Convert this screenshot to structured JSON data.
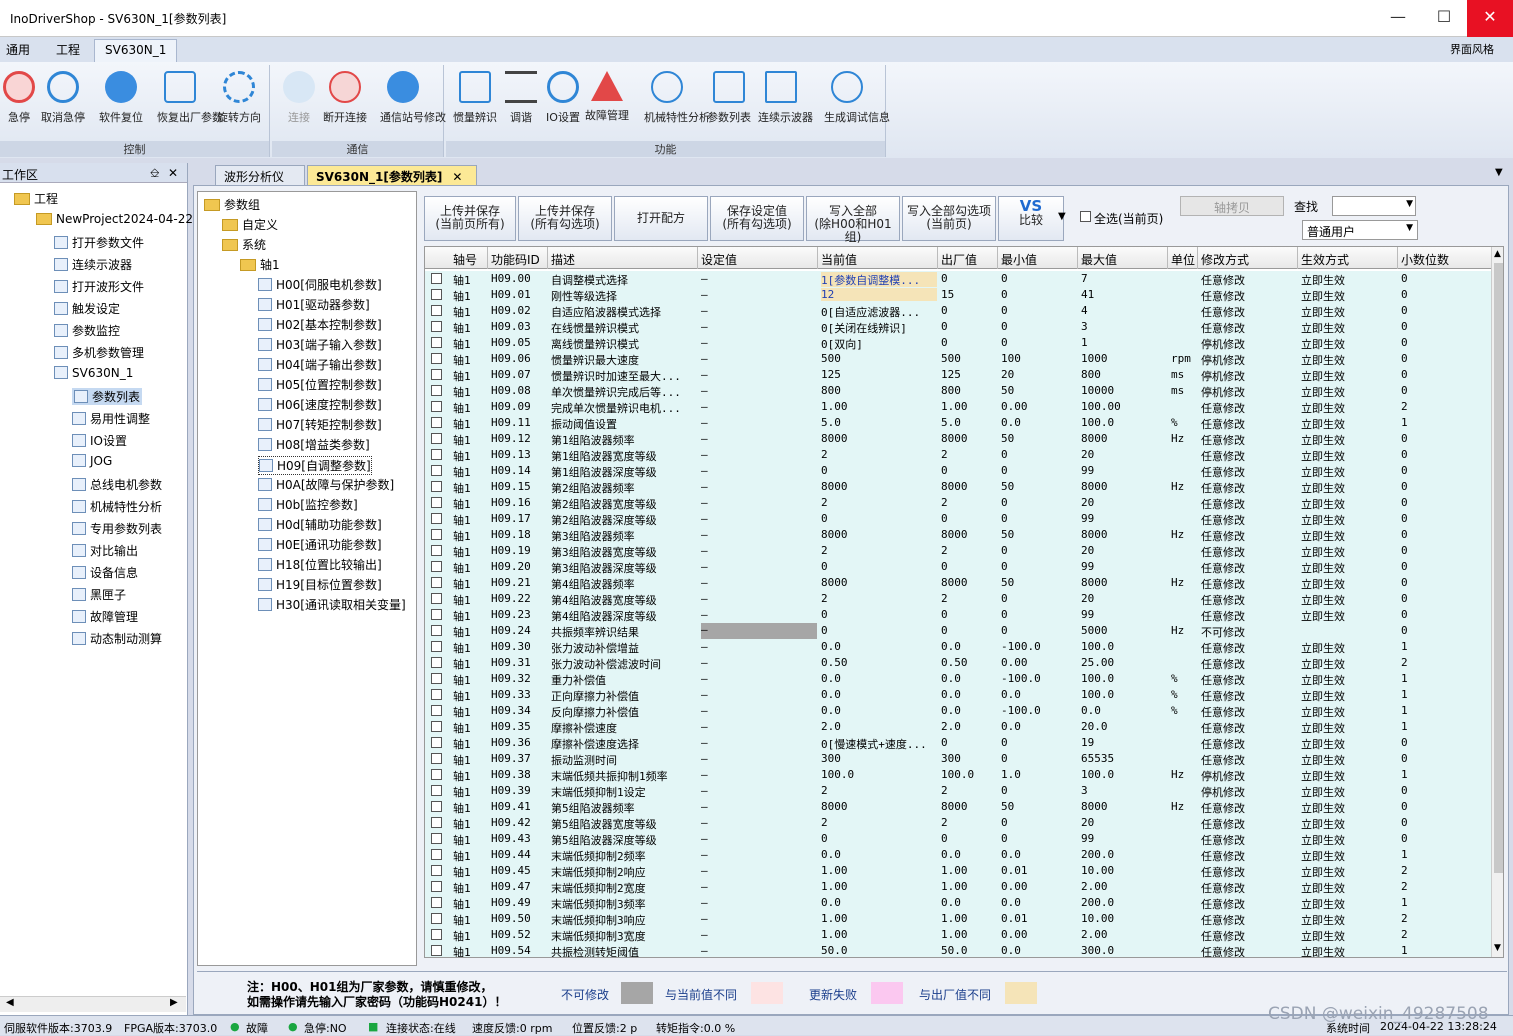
{
  "window": {
    "title": "InoDriverShop - SV630N_1[参数列表]"
  },
  "menu": {
    "items": [
      "通用",
      "工程"
    ],
    "active": "SV630N_1",
    "right": "界面风格"
  },
  "ribbon": {
    "control": {
      "label": "控制",
      "buttons": [
        "急停",
        "取消急停",
        "软件复位",
        "恢复出厂参数",
        "旋转方向"
      ]
    },
    "comm": {
      "label": "通信",
      "buttons": [
        "连接",
        "断开连接",
        "通信站号修改"
      ]
    },
    "func": {
      "label": "功能",
      "buttons": [
        "惯量辨识",
        "调谐",
        "IO设置",
        "故障管理",
        "机械特性分析",
        "参数列表",
        "连续示波器",
        "生成调试信息"
      ]
    }
  },
  "workspace": {
    "title": "工作区",
    "root": "工程",
    "project": "NewProject2024-04-22-",
    "items": [
      "打开参数文件",
      "连续示波器",
      "打开波形文件",
      "触发设定",
      "参数监控",
      "多机参数管理"
    ],
    "device": "SV630N_1",
    "sub": [
      "参数列表",
      "易用性调整",
      "IO设置",
      "JOG",
      "总线电机参数",
      "机械特性分析",
      "专用参数列表",
      "对比输出",
      "设备信息",
      "黑匣子",
      "故障管理",
      "动态制动测算"
    ]
  },
  "tabs": [
    "波形分析仪",
    "SV630N_1[参数列表]"
  ],
  "ptree": {
    "root": "参数组",
    "custom": "自定义",
    "system": "系统",
    "axis": "轴1",
    "groups": [
      "H00[伺服电机参数]",
      "H01[驱动器参数]",
      "H02[基本控制参数]",
      "H03[端子输入参数]",
      "H04[端子输出参数]",
      "H05[位置控制参数]",
      "H06[速度控制参数]",
      "H07[转矩控制参数]",
      "H08[增益类参数]",
      "H09[自调整参数]",
      "H0A[故障与保护参数]",
      "H0b[监控参数]",
      "H0d[辅助功能参数]",
      "H0E[通讯功能参数]",
      "H18[位置比较输出]",
      "H19[目标位置参数]",
      "H30[通讯读取相关变量]"
    ]
  },
  "toolbar": {
    "b1": "上传并保存",
    "b1s": "(当前页所有)",
    "b2": "上传并保存",
    "b2s": "(所有勾选项)",
    "b3": "打开配方",
    "b4": "保存设定值",
    "b4s": "(所有勾选项)",
    "b5": "写入全部",
    "b5s": "(除H00和H01组)",
    "b6": "写入全部勾选项",
    "b6s": "(当前页)",
    "vs": "VS",
    "compare": "比较",
    "selectall": "全选(当前页)",
    "copyaxis": "轴拷贝",
    "search": "查找",
    "user": "普通用户"
  },
  "columns": [
    "轴号",
    "功能码ID",
    "描述",
    "设定值",
    "当前值",
    "出厂值",
    "最小值",
    "最大值",
    "单位",
    "修改方式",
    "生效方式",
    "小数位数"
  ],
  "rows": [
    [
      "轴1",
      "H09.00",
      "自调整模式选择",
      "—",
      "1[参数自调整模...",
      "0",
      "0",
      "7",
      "",
      "任意修改",
      "立即生效",
      "0"
    ],
    [
      "轴1",
      "H09.01",
      "刚性等级选择",
      "—",
      "12",
      "15",
      "0",
      "41",
      "",
      "任意修改",
      "立即生效",
      "0"
    ],
    [
      "轴1",
      "H09.02",
      "自适应陷波器模式选择",
      "—",
      "0[自适应滤波器...",
      "0",
      "0",
      "4",
      "",
      "任意修改",
      "立即生效",
      "0"
    ],
    [
      "轴1",
      "H09.03",
      "在线惯量辨识模式",
      "—",
      "0[关闭在线辨识]",
      "0",
      "0",
      "3",
      "",
      "任意修改",
      "立即生效",
      "0"
    ],
    [
      "轴1",
      "H09.05",
      "离线惯量辨识模式",
      "—",
      "0[双向]",
      "0",
      "0",
      "1",
      "",
      "停机修改",
      "立即生效",
      "0"
    ],
    [
      "轴1",
      "H09.06",
      "惯量辨识最大速度",
      "—",
      "500",
      "500",
      "100",
      "1000",
      "rpm",
      "停机修改",
      "立即生效",
      "0"
    ],
    [
      "轴1",
      "H09.07",
      "惯量辨识时加速至最大...",
      "—",
      "125",
      "125",
      "20",
      "800",
      "ms",
      "停机修改",
      "立即生效",
      "0"
    ],
    [
      "轴1",
      "H09.08",
      "单次惯量辨识完成后等...",
      "—",
      "800",
      "800",
      "50",
      "10000",
      "ms",
      "停机修改",
      "立即生效",
      "0"
    ],
    [
      "轴1",
      "H09.09",
      "完成单次惯量辨识电机...",
      "—",
      "1.00",
      "1.00",
      "0.00",
      "100.00",
      "",
      "任意修改",
      "立即生效",
      "2"
    ],
    [
      "轴1",
      "H09.11",
      "振动阈值设置",
      "—",
      "5.0",
      "5.0",
      "0.0",
      "100.0",
      "%",
      "任意修改",
      "立即生效",
      "1"
    ],
    [
      "轴1",
      "H09.12",
      "第1组陷波器频率",
      "—",
      "8000",
      "8000",
      "50",
      "8000",
      "Hz",
      "任意修改",
      "立即生效",
      "0"
    ],
    [
      "轴1",
      "H09.13",
      "第1组陷波器宽度等级",
      "—",
      "2",
      "2",
      "0",
      "20",
      "",
      "任意修改",
      "立即生效",
      "0"
    ],
    [
      "轴1",
      "H09.14",
      "第1组陷波器深度等级",
      "—",
      "0",
      "0",
      "0",
      "99",
      "",
      "任意修改",
      "立即生效",
      "0"
    ],
    [
      "轴1",
      "H09.15",
      "第2组陷波器频率",
      "—",
      "8000",
      "8000",
      "50",
      "8000",
      "Hz",
      "任意修改",
      "立即生效",
      "0"
    ],
    [
      "轴1",
      "H09.16",
      "第2组陷波器宽度等级",
      "—",
      "2",
      "2",
      "0",
      "20",
      "",
      "任意修改",
      "立即生效",
      "0"
    ],
    [
      "轴1",
      "H09.17",
      "第2组陷波器深度等级",
      "—",
      "0",
      "0",
      "0",
      "99",
      "",
      "任意修改",
      "立即生效",
      "0"
    ],
    [
      "轴1",
      "H09.18",
      "第3组陷波器频率",
      "—",
      "8000",
      "8000",
      "50",
      "8000",
      "Hz",
      "任意修改",
      "立即生效",
      "0"
    ],
    [
      "轴1",
      "H09.19",
      "第3组陷波器宽度等级",
      "—",
      "2",
      "2",
      "0",
      "20",
      "",
      "任意修改",
      "立即生效",
      "0"
    ],
    [
      "轴1",
      "H09.20",
      "第3组陷波器深度等级",
      "—",
      "0",
      "0",
      "0",
      "99",
      "",
      "任意修改",
      "立即生效",
      "0"
    ],
    [
      "轴1",
      "H09.21",
      "第4组陷波器频率",
      "—",
      "8000",
      "8000",
      "50",
      "8000",
      "Hz",
      "任意修改",
      "立即生效",
      "0"
    ],
    [
      "轴1",
      "H09.22",
      "第4组陷波器宽度等级",
      "—",
      "2",
      "2",
      "0",
      "20",
      "",
      "任意修改",
      "立即生效",
      "0"
    ],
    [
      "轴1",
      "H09.23",
      "第4组陷波器深度等级",
      "—",
      "0",
      "0",
      "0",
      "99",
      "",
      "任意修改",
      "立即生效",
      "0"
    ],
    [
      "轴1",
      "H09.24",
      "共振频率辨识结果",
      "—",
      "0",
      "0",
      "0",
      "5000",
      "Hz",
      "不可修改",
      "",
      "0"
    ],
    [
      "轴1",
      "H09.30",
      "张力波动补偿增益",
      "—",
      "0.0",
      "0.0",
      "-100.0",
      "100.0",
      "",
      "任意修改",
      "立即生效",
      "1"
    ],
    [
      "轴1",
      "H09.31",
      "张力波动补偿滤波时间",
      "—",
      "0.50",
      "0.50",
      "0.00",
      "25.00",
      "",
      "任意修改",
      "立即生效",
      "2"
    ],
    [
      "轴1",
      "H09.32",
      "重力补偿值",
      "—",
      "0.0",
      "0.0",
      "-100.0",
      "100.0",
      "%",
      "任意修改",
      "立即生效",
      "1"
    ],
    [
      "轴1",
      "H09.33",
      "正向摩擦力补偿值",
      "—",
      "0.0",
      "0.0",
      "0.0",
      "100.0",
      "%",
      "任意修改",
      "立即生效",
      "1"
    ],
    [
      "轴1",
      "H09.34",
      "反向摩擦力补偿值",
      "—",
      "0.0",
      "0.0",
      "-100.0",
      "0.0",
      "%",
      "任意修改",
      "立即生效",
      "1"
    ],
    [
      "轴1",
      "H09.35",
      "摩擦补偿速度",
      "—",
      "2.0",
      "2.0",
      "0.0",
      "20.0",
      "",
      "任意修改",
      "立即生效",
      "1"
    ],
    [
      "轴1",
      "H09.36",
      "摩擦补偿速度选择",
      "—",
      "0[慢速模式+速度...",
      "0",
      "0",
      "19",
      "",
      "任意修改",
      "立即生效",
      "0"
    ],
    [
      "轴1",
      "H09.37",
      "振动监测时间",
      "—",
      "300",
      "300",
      "0",
      "65535",
      "",
      "任意修改",
      "立即生效",
      "0"
    ],
    [
      "轴1",
      "H09.38",
      "末端低频共振抑制1频率",
      "—",
      "100.0",
      "100.0",
      "1.0",
      "100.0",
      "Hz",
      "停机修改",
      "立即生效",
      "1"
    ],
    [
      "轴1",
      "H09.39",
      "末端低频抑制1设定",
      "—",
      "2",
      "2",
      "0",
      "3",
      "",
      "停机修改",
      "立即生效",
      "0"
    ],
    [
      "轴1",
      "H09.41",
      "第5组陷波器频率",
      "—",
      "8000",
      "8000",
      "50",
      "8000",
      "Hz",
      "任意修改",
      "立即生效",
      "0"
    ],
    [
      "轴1",
      "H09.42",
      "第5组陷波器宽度等级",
      "—",
      "2",
      "2",
      "0",
      "20",
      "",
      "任意修改",
      "立即生效",
      "0"
    ],
    [
      "轴1",
      "H09.43",
      "第5组陷波器深度等级",
      "—",
      "0",
      "0",
      "0",
      "99",
      "",
      "任意修改",
      "立即生效",
      "0"
    ],
    [
      "轴1",
      "H09.44",
      "末端低频抑制2频率",
      "—",
      "0.0",
      "0.0",
      "0.0",
      "200.0",
      "",
      "任意修改",
      "立即生效",
      "1"
    ],
    [
      "轴1",
      "H09.45",
      "末端低频抑制2响应",
      "—",
      "1.00",
      "1.00",
      "0.01",
      "10.00",
      "",
      "任意修改",
      "立即生效",
      "2"
    ],
    [
      "轴1",
      "H09.47",
      "末端低频抑制2宽度",
      "—",
      "1.00",
      "1.00",
      "0.00",
      "2.00",
      "",
      "任意修改",
      "立即生效",
      "2"
    ],
    [
      "轴1",
      "H09.49",
      "末端低频抑制3频率",
      "—",
      "0.0",
      "0.0",
      "0.0",
      "200.0",
      "",
      "任意修改",
      "立即生效",
      "1"
    ],
    [
      "轴1",
      "H09.50",
      "末端低频抑制3响应",
      "—",
      "1.00",
      "1.00",
      "0.01",
      "10.00",
      "",
      "任意修改",
      "立即生效",
      "2"
    ],
    [
      "轴1",
      "H09.52",
      "末端低频抑制3宽度",
      "—",
      "1.00",
      "1.00",
      "0.00",
      "2.00",
      "",
      "任意修改",
      "立即生效",
      "2"
    ],
    [
      "轴1",
      "H09.54",
      "共振检测转矩阈值",
      "—",
      "50.0",
      "50.0",
      "0.0",
      "300.0",
      "",
      "任意修改",
      "立即生效",
      "1"
    ]
  ],
  "legend": {
    "note1": "注：H00、H01组为厂家参数，请慎重修改，",
    "note2": "如需操作请先输入厂家密码（功能码H0241）！",
    "l1": "不可修改",
    "l2": "与当前值不同",
    "l3": "更新失败",
    "l4": "与出厂值不同",
    "c1": "#a6a6a6",
    "c2": "#fde3e3",
    "c3": "#fbc8f0",
    "c4": "#f5e4b8"
  },
  "status": {
    "sw": "伺服软件版本:3703.9",
    "fpga": "FPGA版本:3703.0",
    "fault": "故障",
    "estop": "急停:NO",
    "conn": "连接状态:在线",
    "speed": "速度反馈:0 rpm",
    "pos": "位置反馈:2 p",
    "torque": "转矩指令:0.0 %",
    "systime": "系统时间",
    "time": "2024-04-22 13:28:24",
    "watermark": "CSDN @weixin_49287508"
  }
}
